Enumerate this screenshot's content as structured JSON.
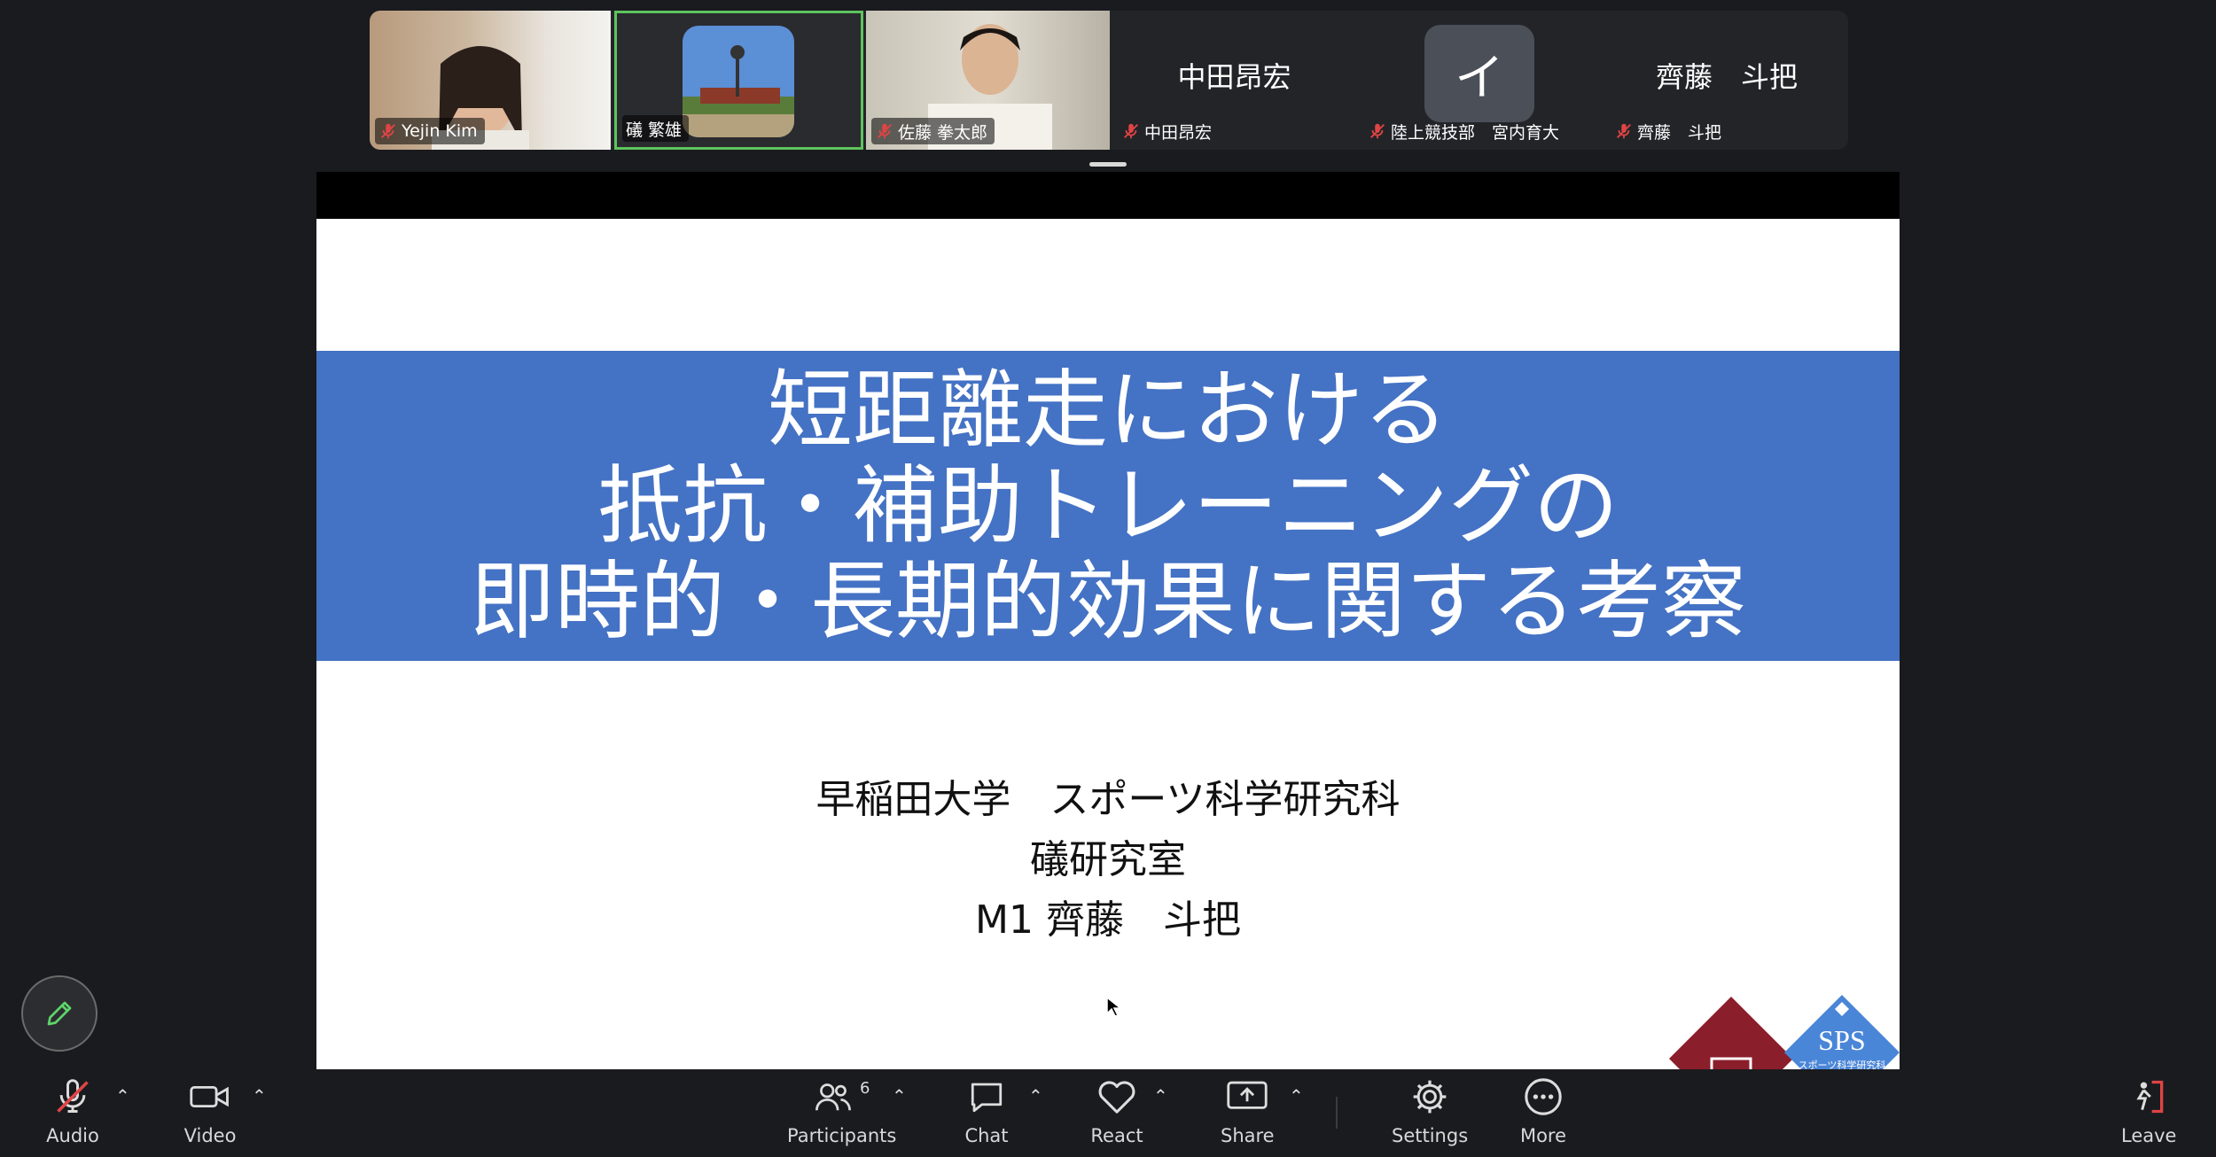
{
  "participants": [
    {
      "name": "Yejin Kim",
      "muted": true
    },
    {
      "name": "礒 繁雄",
      "muted": false
    },
    {
      "name": "佐藤 拳太郎",
      "muted": true
    },
    {
      "name": "中田昂宏",
      "display": "中田昂宏",
      "muted": true
    },
    {
      "name": "陸上競技部　宮内育大",
      "avatar_letter": "イ",
      "muted": true
    },
    {
      "name": "齊藤　斗把",
      "display": "齊藤　斗把",
      "muted": true
    }
  ],
  "slide": {
    "title_lines": [
      "短距離走における",
      "抵抗・補助トレーニングの",
      "即時的・長期的効果に関する考察"
    ],
    "affiliation": "早稲田大学　スポーツ科学研究科",
    "lab": "礒研究室",
    "author": "M1 齊藤　斗把",
    "logo_text": "SPS",
    "logo_subtext": "スポーツ科学研究科",
    "colors": {
      "band": "#4472c4"
    }
  },
  "toolbar": {
    "audio": "Audio",
    "video": "Video",
    "participants": "Participants",
    "participants_count": "6",
    "chat": "Chat",
    "react": "React",
    "share": "Share",
    "settings": "Settings",
    "more": "More",
    "leave": "Leave"
  },
  "icons": [
    "pencil-icon",
    "mic-muted-icon",
    "camera-icon",
    "participants-icon",
    "chat-icon",
    "heart-icon",
    "share-icon",
    "gear-icon",
    "more-icon",
    "leave-icon"
  ]
}
